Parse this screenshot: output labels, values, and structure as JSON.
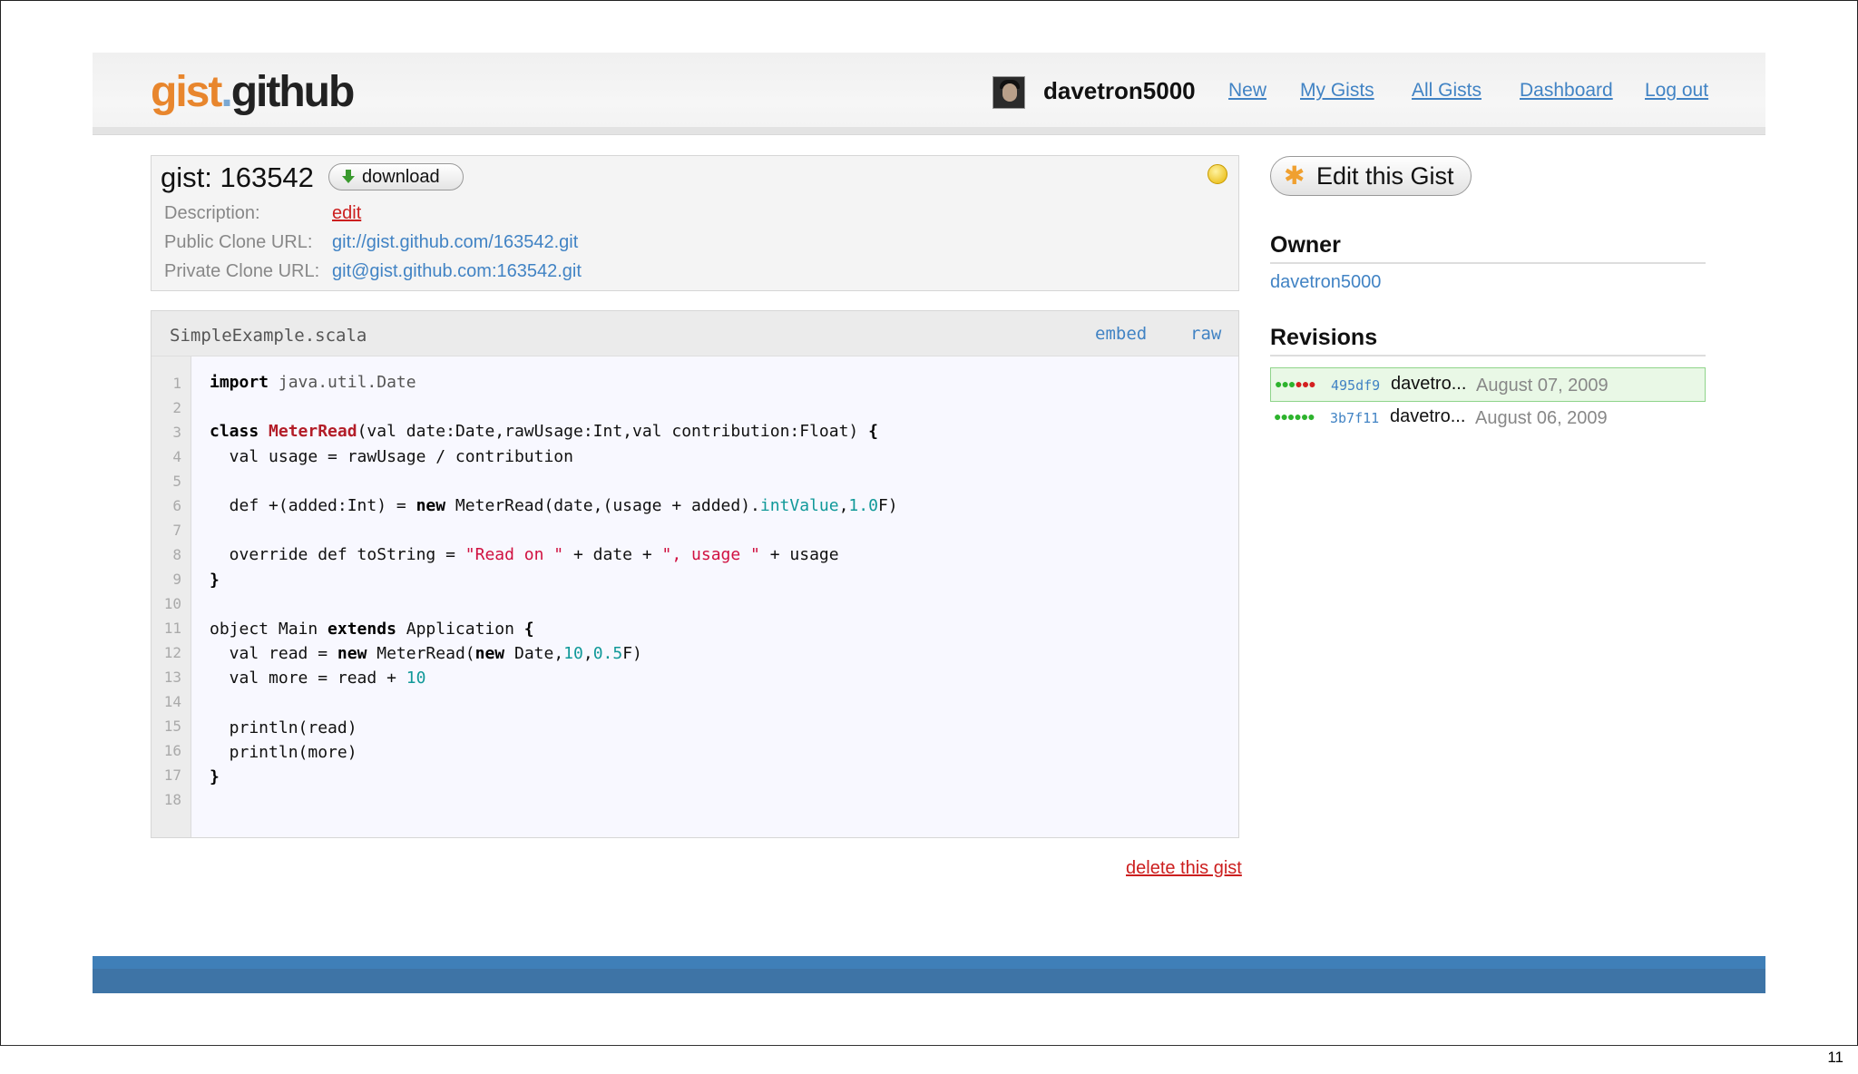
{
  "header": {
    "logo_part1": "gist",
    "logo_dot": ".",
    "logo_part2": "github",
    "username": "davetron5000",
    "nav": [
      "New",
      "My Gists",
      "All Gists",
      "Dashboard",
      "Log out"
    ]
  },
  "gist": {
    "title": "gist: 163542",
    "download_label": "download",
    "description_label": "Description:",
    "description_edit": "edit",
    "public_clone_label": "Public Clone URL:",
    "public_clone_url": "git://gist.github.com/163542.git",
    "private_clone_label": "Private Clone URL:",
    "private_clone_url": "git@gist.github.com:163542.git"
  },
  "file": {
    "name": "SimpleExample.scala",
    "embed_label": "embed",
    "raw_label": "raw",
    "line_numbers": [
      "1",
      "2",
      "3",
      "4",
      "5",
      "6",
      "7",
      "8",
      "9",
      "10",
      "11",
      "12",
      "13",
      "14",
      "15",
      "16",
      "17",
      "18"
    ]
  },
  "delete_label": "delete this gist",
  "sidebar": {
    "edit_label": "Edit this Gist",
    "owner_heading": "Owner",
    "owner": "davetron5000",
    "revisions_heading": "Revisions",
    "revisions": [
      {
        "hash": "495df9",
        "author": "davetro...",
        "date": "August 07, 2009"
      },
      {
        "hash": "3b7f11",
        "author": "davetro...",
        "date": "August 06, 2009"
      }
    ]
  },
  "slide_number": "11",
  "colors": {
    "link": "#4183c4",
    "danger": "#cc1f1f",
    "footer": "#3e74a6",
    "revision_highlight": "#e9f8e6"
  }
}
